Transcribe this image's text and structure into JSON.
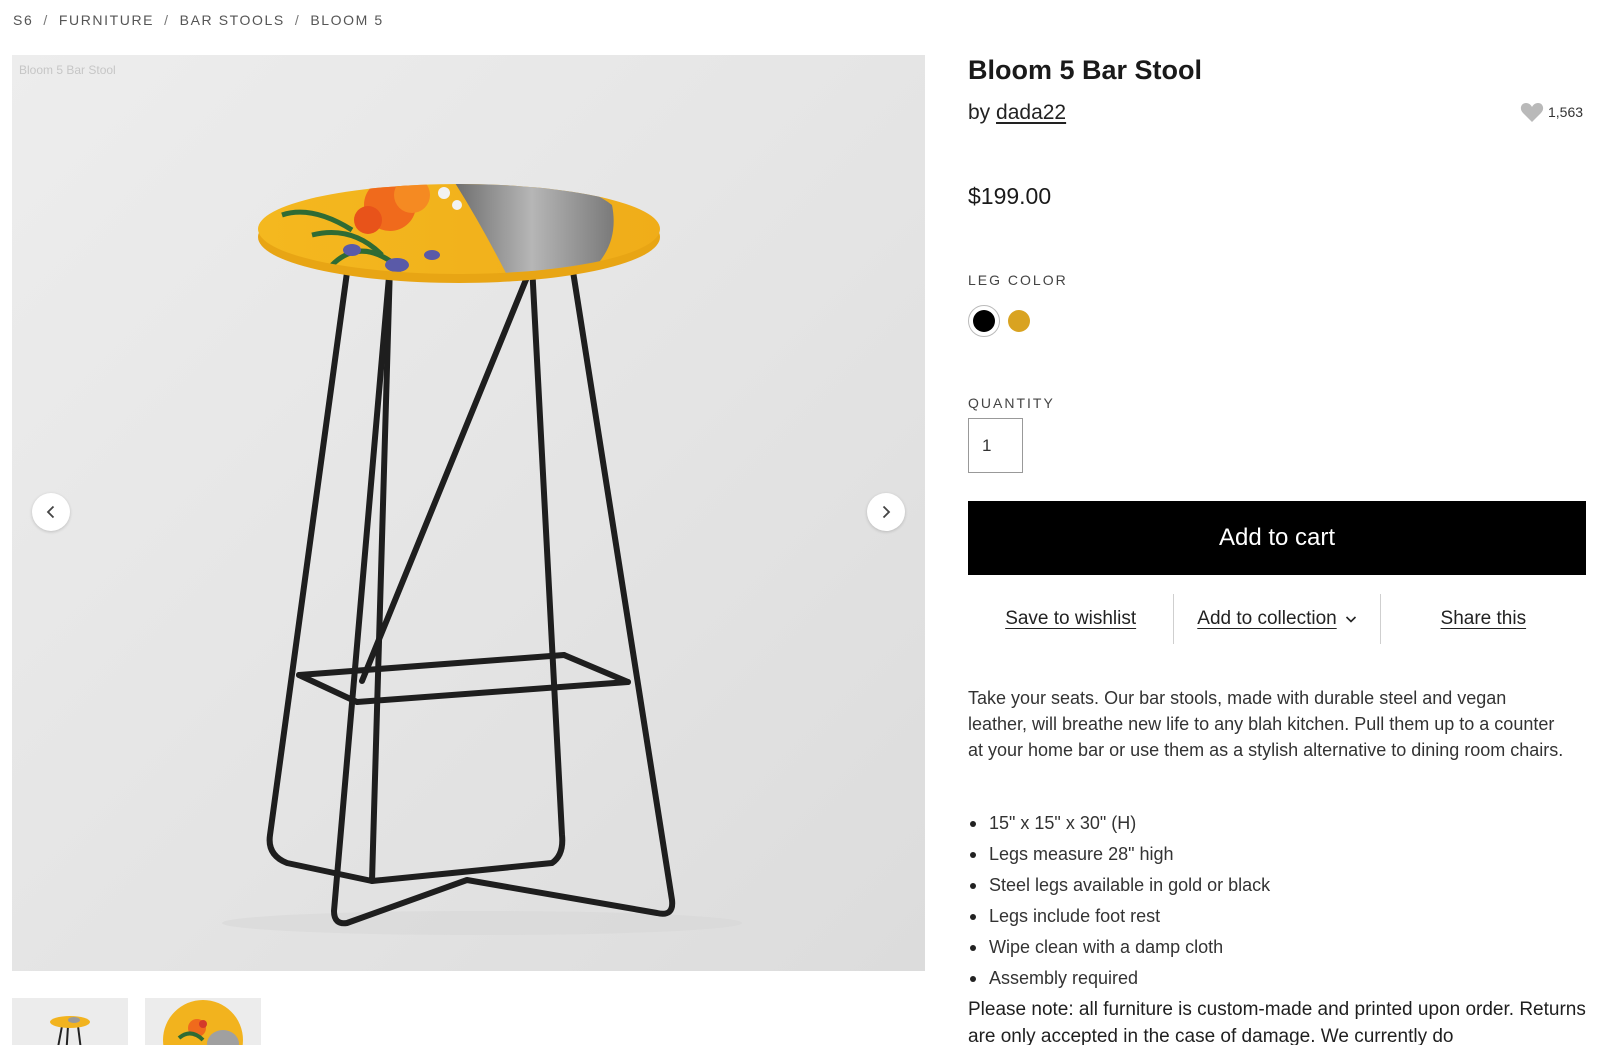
{
  "breadcrumb": {
    "items": [
      "S6",
      "FURNITURE",
      "BAR STOOLS",
      "BLOOM 5"
    ],
    "separator": "/"
  },
  "gallery": {
    "caption": "Bloom 5 Bar Stool",
    "prev_icon": "chevron-left-icon",
    "next_icon": "chevron-right-icon",
    "thumbnails": [
      "thumbnail-stool-front",
      "thumbnail-seat-top"
    ]
  },
  "product": {
    "title": "Bloom 5 Bar Stool",
    "by_label": "by",
    "artist": "dada22",
    "likes": "1,563",
    "price": "$199.00",
    "leg_color_label": "LEG COLOR",
    "leg_colors": [
      {
        "name": "black",
        "hex": "#000000",
        "selected": true
      },
      {
        "name": "gold",
        "hex": "#d9a321",
        "selected": false
      }
    ],
    "quantity_label": "QUANTITY",
    "quantity": "1",
    "add_to_cart": "Add to cart",
    "actions": {
      "wishlist": "Save to wishlist",
      "collection": "Add to collection",
      "share": "Share this"
    },
    "description": "Take your seats. Our bar stools, made with durable steel and vegan leather, will breathe new life to any blah kitchen. Pull them up to a counter at your home bar or use them as a stylish alternative to dining room chairs.",
    "features": [
      "15\" x 15\" x 30\" (H)",
      "Legs measure 28\" high",
      "Steel legs available in gold or black",
      "Legs include foot rest",
      "Wipe clean with a damp cloth",
      "Assembly required"
    ],
    "note": "Please note: all furniture is custom-made and printed upon order. Returns are only accepted in the case of damage. We currently do"
  },
  "colors": {
    "button_bg": "#000000",
    "seat_yellow": "#f2b31e",
    "leg_black": "#1c1c1c"
  }
}
